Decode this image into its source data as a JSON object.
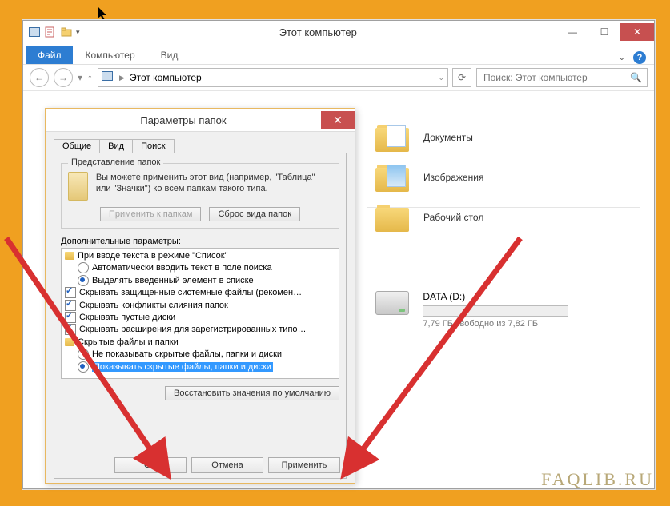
{
  "explorer": {
    "title": "Этот компьютер",
    "file_tab": "Файл",
    "tabs": [
      "Компьютер",
      "Вид"
    ],
    "addr_text": "Этот компьютер",
    "search_placeholder": "Поиск: Этот компьютер",
    "folders": [
      {
        "label": "Документы"
      },
      {
        "label": "Изображения"
      },
      {
        "label": "Рабочий стол"
      }
    ],
    "drive": {
      "label": "DATA (D:)",
      "sub": "7,79 ГБ свободно из 7,82 ГБ"
    }
  },
  "dialog": {
    "title": "Параметры папок",
    "tabs": {
      "general": "Общие",
      "view": "Вид",
      "search": "Поиск"
    },
    "folder_views": {
      "legend": "Представление папок",
      "text": "Вы можете применить этот вид (например, \"Таблица\" или \"Значки\") ко всем папкам такого типа.",
      "apply": "Применить к папкам",
      "reset": "Сброс вида папок"
    },
    "advanced_label": "Дополнительные параметры:",
    "tree": {
      "n0": "При вводе текста в режиме \"Список\"",
      "n0a": "Автоматически вводить текст в поле поиска",
      "n0b": "Выделять введенный элемент в списке",
      "n1": "Скрывать защищенные системные файлы (рекомен…",
      "n2": "Скрывать конфликты слияния папок",
      "n3": "Скрывать пустые диски",
      "n4": "Скрывать расширения для зарегистрированных типо…",
      "n5": "Скрытые файлы и папки",
      "n5a": "Не показывать скрытые файлы, папки и диски",
      "n5b": "Показывать скрытые файлы, папки и диски"
    },
    "restore": "Восстановить значения по умолчанию",
    "ok": "OK",
    "cancel": "Отмена",
    "apply": "Применить"
  },
  "watermark": "FAQLIB.RU"
}
